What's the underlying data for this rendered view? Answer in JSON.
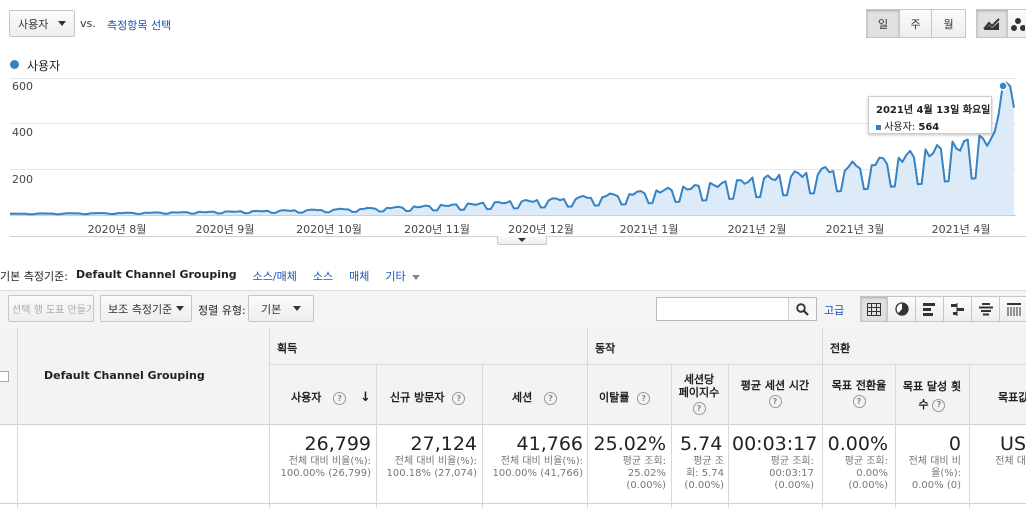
{
  "toolbar": {
    "metric_select": "사용자",
    "vs_label": "vs.",
    "select_metric_link": "측정항목 선택",
    "period_buttons": [
      "일",
      "주",
      "월"
    ]
  },
  "legend": {
    "series_label": "사용자",
    "color": "#3582c4"
  },
  "chart_data": {
    "type": "area",
    "series": [
      {
        "name": "사용자",
        "color": "#3582c4"
      }
    ],
    "yticks": [
      "600",
      "400",
      "200"
    ],
    "ylim": [
      0,
      600
    ],
    "xticks": [
      "2020년 8월",
      "2020년 9월",
      "2020년 10월",
      "2020년 11월",
      "2020년 12월",
      "2021년 1월",
      "2021년 2월",
      "2021년 3월",
      "2021년 4월"
    ],
    "tooltip": {
      "date": "2021년 4월 13일 화요일",
      "label": "사용자:",
      "value": "564"
    }
  },
  "dimension_bar": {
    "label": "기본 측정기준:",
    "active": "Default Channel Grouping",
    "links": [
      "소스/매체",
      "소스",
      "매체"
    ],
    "more": "기타"
  },
  "controls": {
    "plot_rows_button": "선택 행 도표 만들기",
    "secondary_dimension": "보조 측정기준",
    "sort_type_label": "정렬 유형:",
    "sort_type_value": "기본",
    "advanced_link": "고급"
  },
  "table": {
    "dimension_header": "Default Channel Grouping",
    "groups": [
      "획득",
      "동작",
      "전환"
    ],
    "columns": [
      "사용자",
      "신규 방문자",
      "세션",
      "이탈률",
      "세션당 페이지수",
      "평균 세션 시간",
      "목표 전환율",
      "목표 달성 횟수",
      "목표값"
    ],
    "totals": [
      {
        "value": "26,799",
        "sub1": "전체 대비 비율(%):",
        "sub2": "100.00% (26,799)"
      },
      {
        "value": "27,124",
        "sub1": "전체 대비 비율(%):",
        "sub2": "100.18% (27,074)"
      },
      {
        "value": "41,766",
        "sub1": "전체 대비 비율(%):",
        "sub2": "100.00% (41,766)"
      },
      {
        "value": "25.02%",
        "sub1": "평균 조회:",
        "sub2": "25.02%",
        "sub3": "(0.00%)"
      },
      {
        "value": "5.74",
        "sub1": "평균 조",
        "sub2": "회: 5.74",
        "sub3": "(0.00%)"
      },
      {
        "value": "00:03:17",
        "sub1": "평균 조회:",
        "sub2": "00:03:17",
        "sub3": "(0.00%)"
      },
      {
        "value": "0.00%",
        "sub1": "평균 조회:",
        "sub2": "0.00%",
        "sub3": "(0.00%)"
      },
      {
        "value": "0",
        "sub1": "전체 대비 비",
        "sub2": "율(%):",
        "sub3": "0.00% (0)"
      },
      {
        "value": "US",
        "sub1": "전체 대",
        "sub2": "",
        "sub3": ""
      }
    ]
  }
}
